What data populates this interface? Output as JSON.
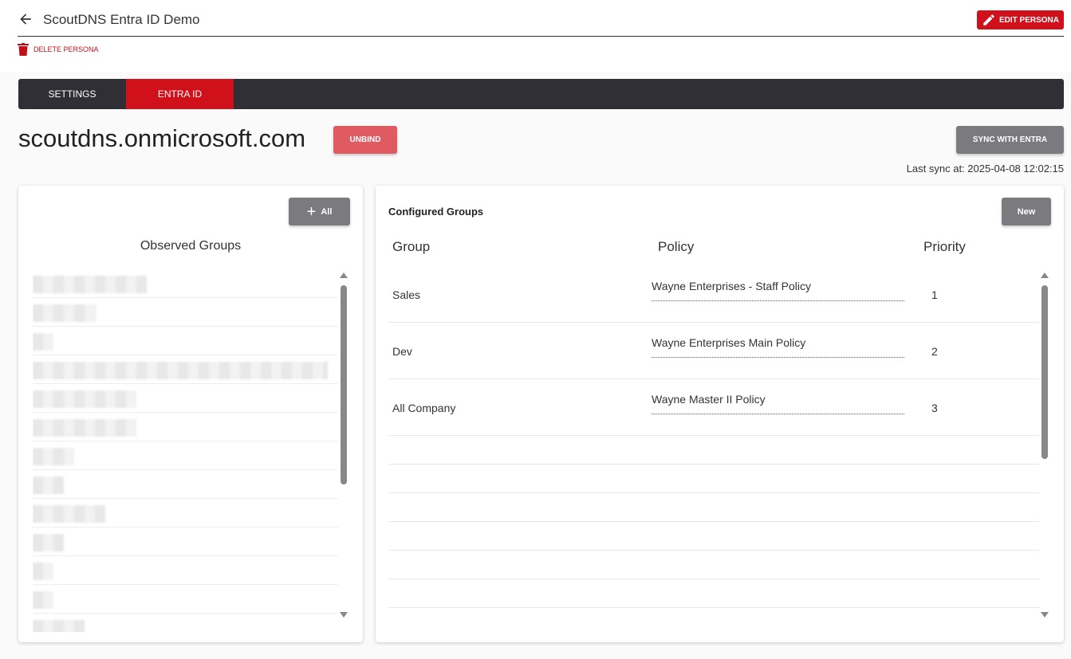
{
  "header": {
    "title": "ScoutDNS Entra ID Demo",
    "edit_label": "EDIT PERSONA",
    "delete_label": "DELETE PERSONA"
  },
  "tabs": [
    {
      "label": "SETTINGS",
      "active": false
    },
    {
      "label": "ENTRA ID",
      "active": true
    }
  ],
  "domain": {
    "name": "scoutdns.onmicrosoft.com",
    "unbind_label": "UNBIND",
    "sync_label": "SYNC WITH ENTRA",
    "last_sync": "Last sync at: 2025-04-08 12:02:15"
  },
  "observed": {
    "add_all_label": "All",
    "title": "Observed Groups"
  },
  "configured": {
    "title": "Configured Groups",
    "new_label": "New",
    "columns": [
      "Group",
      "Policy",
      "Priority"
    ],
    "rows": [
      {
        "group": "Sales",
        "policy": "Wayne Enterprises - Staff Policy",
        "priority": "1"
      },
      {
        "group": "Dev",
        "policy": "Wayne Enterprises  Main Policy",
        "priority": "2"
      },
      {
        "group": "All Company",
        "policy": "Wayne Master II Policy",
        "priority": "3"
      }
    ]
  },
  "colors": {
    "accent": "#d0101a",
    "unbind": "#e05a62",
    "tabbar": "#2f2f35",
    "button_gray": "#7a7a7f"
  }
}
